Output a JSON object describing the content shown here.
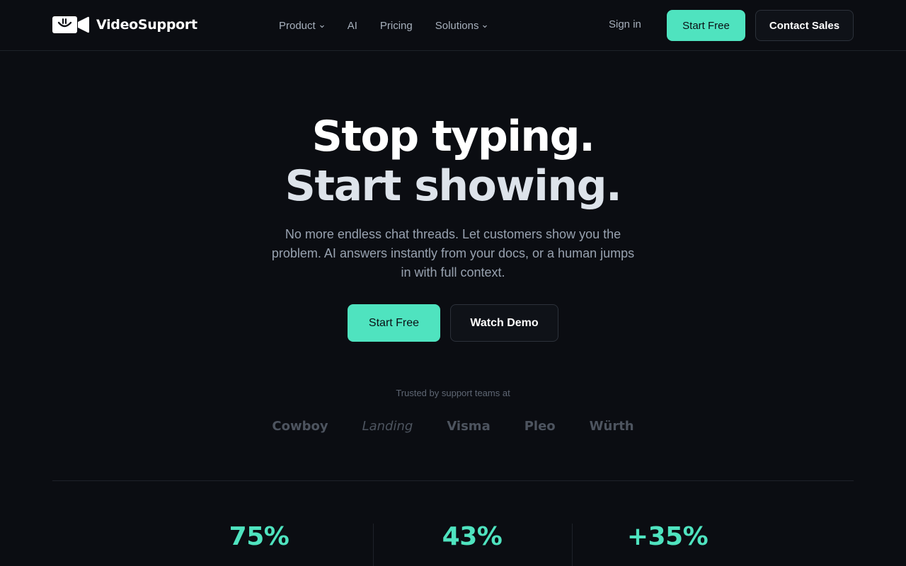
{
  "header": {
    "brand": {
      "name": "VideoSupport",
      "icon": "video-chat-logo-icon"
    },
    "nav": [
      {
        "label": "Product",
        "has_dropdown": true
      },
      {
        "label": "AI",
        "has_dropdown": false
      },
      {
        "label": "Pricing",
        "has_dropdown": false
      },
      {
        "label": "Solutions",
        "has_dropdown": true
      }
    ],
    "sign_in": "Sign in",
    "start_free": "Start Free",
    "contact_sales": "Contact Sales"
  },
  "hero": {
    "title_line1": "Stop typing.",
    "title_line2": "Start showing.",
    "subtitle": "No more endless chat threads. Let customers show you the problem. AI answers instantly from your docs, or a human jumps in with full context.",
    "cta_primary": "Start Free",
    "cta_secondary": "Watch Demo"
  },
  "trusted": {
    "label": "Trusted by support teams at",
    "logos": [
      "Cowboy",
      "Landing",
      "Visma",
      "Pleo",
      "Würth"
    ]
  },
  "stats": [
    "75%",
    "43%",
    "+35%"
  ],
  "colors": {
    "background": "#0b0d12",
    "accent": "#4fe3bf",
    "muted_text": "#98a2b0",
    "border": "#1e2229"
  }
}
